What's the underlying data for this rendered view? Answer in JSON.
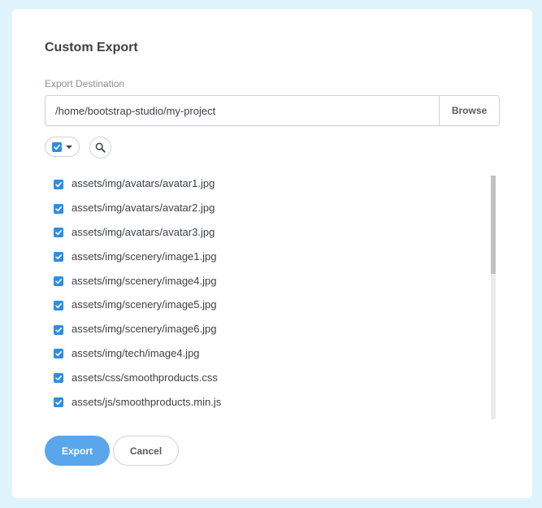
{
  "dialog": {
    "title": "Custom Export",
    "destination_label": "Export Destination",
    "destination_value": "/home/bootstrap-studio/my-project",
    "browse_label": "Browse",
    "export_label": "Export",
    "cancel_label": "Cancel"
  },
  "toolbar": {
    "select_all_checked": true,
    "search_icon": "search-icon",
    "caret_icon": "caret-down-icon"
  },
  "files": [
    {
      "name": "assets/img/avatars/avatar1.jpg",
      "checked": true
    },
    {
      "name": "assets/img/avatars/avatar2.jpg",
      "checked": true
    },
    {
      "name": "assets/img/avatars/avatar3.jpg",
      "checked": true
    },
    {
      "name": "assets/img/scenery/image1.jpg",
      "checked": true
    },
    {
      "name": "assets/img/scenery/image4.jpg",
      "checked": true
    },
    {
      "name": "assets/img/scenery/image5.jpg",
      "checked": true
    },
    {
      "name": "assets/img/scenery/image6.jpg",
      "checked": true
    },
    {
      "name": "assets/img/tech/image4.jpg",
      "checked": true
    },
    {
      "name": "assets/css/smoothproducts.css",
      "checked": true
    },
    {
      "name": "assets/js/smoothproducts.min.js",
      "checked": true
    }
  ],
  "colors": {
    "background": "#dff3fd",
    "accent": "#5aa6ea",
    "checkbox": "#2f8de0"
  }
}
